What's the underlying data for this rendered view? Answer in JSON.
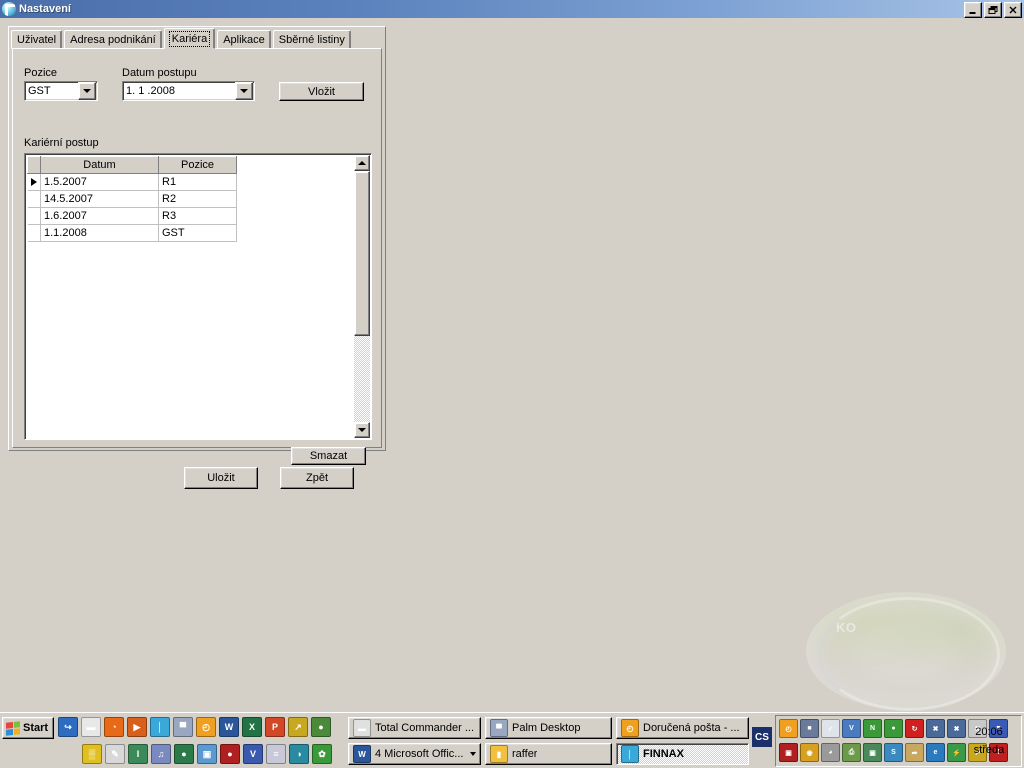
{
  "window": {
    "title": "Nastavení",
    "icon": "finnax-logo-icon",
    "buttons": {
      "minimize": "minimize-icon",
      "restore": "restore-icon",
      "close": "close-icon"
    }
  },
  "tabs": [
    {
      "label": "Uživatel",
      "active": false
    },
    {
      "label": "Adresa podnikání",
      "active": false
    },
    {
      "label": "Kariéra",
      "active": true
    },
    {
      "label": "Aplikace",
      "active": false
    },
    {
      "label": "Sběrné listiny",
      "active": false
    }
  ],
  "form": {
    "pozice_label": "Pozice",
    "pozice_value": "GST",
    "datum_label": "Datum postupu",
    "datum_value": "1. 1 .2008",
    "insert_button": "Vložit",
    "grid_label": "Kariérní postup",
    "delete_button": "Smazat"
  },
  "grid": {
    "columns": [
      "Datum",
      "Pozice"
    ],
    "rows": [
      {
        "selected": true,
        "datum": "1.5.2007",
        "pozice": "R1"
      },
      {
        "selected": false,
        "datum": "14.5.2007",
        "pozice": "R2"
      },
      {
        "selected": false,
        "datum": "1.6.2007",
        "pozice": "R3"
      },
      {
        "selected": false,
        "datum": "1.1.2008",
        "pozice": "GST"
      }
    ]
  },
  "dialog_buttons": {
    "save": "Uložit",
    "back": "Zpět"
  },
  "desktop": {
    "watermark_text": "KO"
  },
  "taskbar": {
    "start_label": "Start",
    "quicklaunch_row1": [
      {
        "name": "show-desktop-icon",
        "color": "#2d6cc0",
        "glyph": "↪"
      },
      {
        "name": "save-floppy-icon",
        "color": "#e8e8e8",
        "glyph": "▬"
      },
      {
        "name": "firefox-icon",
        "color": "#e86a16",
        "glyph": "◔"
      },
      {
        "name": "media-player-icon",
        "color": "#d8601a",
        "glyph": "▶"
      },
      {
        "name": "finnax-icon",
        "color": "#3aa8d8",
        "glyph": "│"
      },
      {
        "name": "remote-desktop-icon",
        "color": "#9aa7c0",
        "glyph": "▀"
      },
      {
        "name": "clock-icon",
        "color": "#f0a020",
        "glyph": "◴"
      },
      {
        "name": "word-icon",
        "color": "#2b579a",
        "glyph": "W"
      },
      {
        "name": "excel-icon",
        "color": "#217346",
        "glyph": "X"
      },
      {
        "name": "powerpoint-icon",
        "color": "#d24726",
        "glyph": "P"
      },
      {
        "name": "shortcut-arrow-icon",
        "color": "#c8a820",
        "glyph": "↗"
      },
      {
        "name": "internet-globe-icon",
        "color": "#4a8a3a",
        "glyph": "●"
      }
    ],
    "quicklaunch_row2": [
      {
        "name": "calculator-icon",
        "color": "#e0c020",
        "glyph": "▒"
      },
      {
        "name": "paint-icon",
        "color": "#d8d8d8",
        "glyph": "✎"
      },
      {
        "name": "ico-editor-icon",
        "color": "#3a8a5a",
        "glyph": "I"
      },
      {
        "name": "music-player-icon",
        "color": "#7a8ac0",
        "glyph": "♫"
      },
      {
        "name": "browser-globe-icon",
        "color": "#2a7a4a",
        "glyph": "●"
      },
      {
        "name": "image-viewer-icon",
        "color": "#5a9ad0",
        "glyph": "▣"
      },
      {
        "name": "cd-burner-icon",
        "color": "#b02020",
        "glyph": "●"
      },
      {
        "name": "vlc-cone-icon",
        "color": "#3a5ab0",
        "glyph": "V"
      },
      {
        "name": "notepad-icon",
        "color": "#c8c8d8",
        "glyph": "≡"
      },
      {
        "name": "database-icon",
        "color": "#2a8aa0",
        "glyph": "◑"
      },
      {
        "name": "icq-flower-icon",
        "color": "#3a9a3a",
        "glyph": "✿"
      }
    ],
    "tasks_row1": [
      {
        "label": "Total Commander ...",
        "icon": "floppy-icon",
        "color": "#e0e0e0",
        "glyph": "▬",
        "pressed": false,
        "has_more": false
      },
      {
        "label": "Palm Desktop",
        "icon": "palm-icon",
        "color": "#9aa7c0",
        "glyph": "▀",
        "pressed": false,
        "has_more": false
      },
      {
        "label": "Doručená pošta - ...",
        "icon": "clock-icon",
        "color": "#f0a020",
        "glyph": "◴",
        "pressed": false,
        "has_more": false
      }
    ],
    "tasks_row2": [
      {
        "label": "4 Microsoft Offic...",
        "icon": "word-icon",
        "color": "#2b579a",
        "glyph": "W",
        "pressed": false,
        "has_more": true
      },
      {
        "label": "raffer",
        "icon": "folder-icon",
        "color": "#f0c040",
        "glyph": "▮",
        "pressed": false,
        "has_more": false
      },
      {
        "label": "FINNAX",
        "icon": "finnax-icon",
        "color": "#3aa8d8",
        "glyph": "│",
        "pressed": true,
        "has_more": false
      }
    ],
    "language_indicator": "CS",
    "tray_row1": [
      {
        "name": "clock-tray-icon",
        "color": "#f0a020",
        "glyph": "◴"
      },
      {
        "name": "network-tray-icon",
        "color": "#6a7a9a",
        "glyph": "■"
      },
      {
        "name": "shield-check-tray-icon",
        "color": "#dfe4ea",
        "glyph": "✓"
      },
      {
        "name": "antivirus-tray-icon",
        "color": "#4a7ac0",
        "glyph": "V"
      },
      {
        "name": "nvidia-tray-icon",
        "color": "#3a9a3a",
        "glyph": "N"
      },
      {
        "name": "green-ball-tray-icon",
        "color": "#3a9a3a",
        "glyph": "●"
      },
      {
        "name": "sync-tray-icon",
        "color": "#d02020",
        "glyph": "↻"
      },
      {
        "name": "network-off-tray-icon",
        "color": "#4a6a9a",
        "glyph": "✖"
      },
      {
        "name": "network-off2-tray-icon",
        "color": "#4a6a9a",
        "glyph": "✖"
      },
      {
        "name": "volume-mute-tray-icon",
        "color": "#c8c8c8",
        "glyph": "✖"
      },
      {
        "name": "security-shield-icon",
        "color": "#3a5ab8",
        "glyph": "▼"
      }
    ],
    "tray_row2": [
      {
        "name": "screenshot-tray-icon",
        "color": "#b02020",
        "glyph": "▣"
      },
      {
        "name": "wireless-tray-icon",
        "color": "#d8a020",
        "glyph": "◉"
      },
      {
        "name": "volume-tray-icon",
        "color": "#9a9a9a",
        "glyph": "◕"
      },
      {
        "name": "printer-tray-icon",
        "color": "#6a9a4a",
        "glyph": "⎙"
      },
      {
        "name": "monitor-tray-icon",
        "color": "#4a8a5a",
        "glyph": "▣"
      },
      {
        "name": "sis-tray-icon",
        "color": "#3a8ac0",
        "glyph": "S"
      },
      {
        "name": "mouse-tray-icon",
        "color": "#c8a860",
        "glyph": "➦"
      },
      {
        "name": "explorer-tray-icon",
        "color": "#2a7ac0",
        "glyph": "e"
      },
      {
        "name": "power-tray-icon",
        "color": "#3a9a4a",
        "glyph": "⚡"
      },
      {
        "name": "shortcut-tray-icon",
        "color": "#c8a820",
        "glyph": "↗"
      },
      {
        "name": "alert-shield-tray-icon",
        "color": "#c02020",
        "glyph": "!"
      }
    ],
    "clock_time": "20:06",
    "clock_day": "středa"
  }
}
